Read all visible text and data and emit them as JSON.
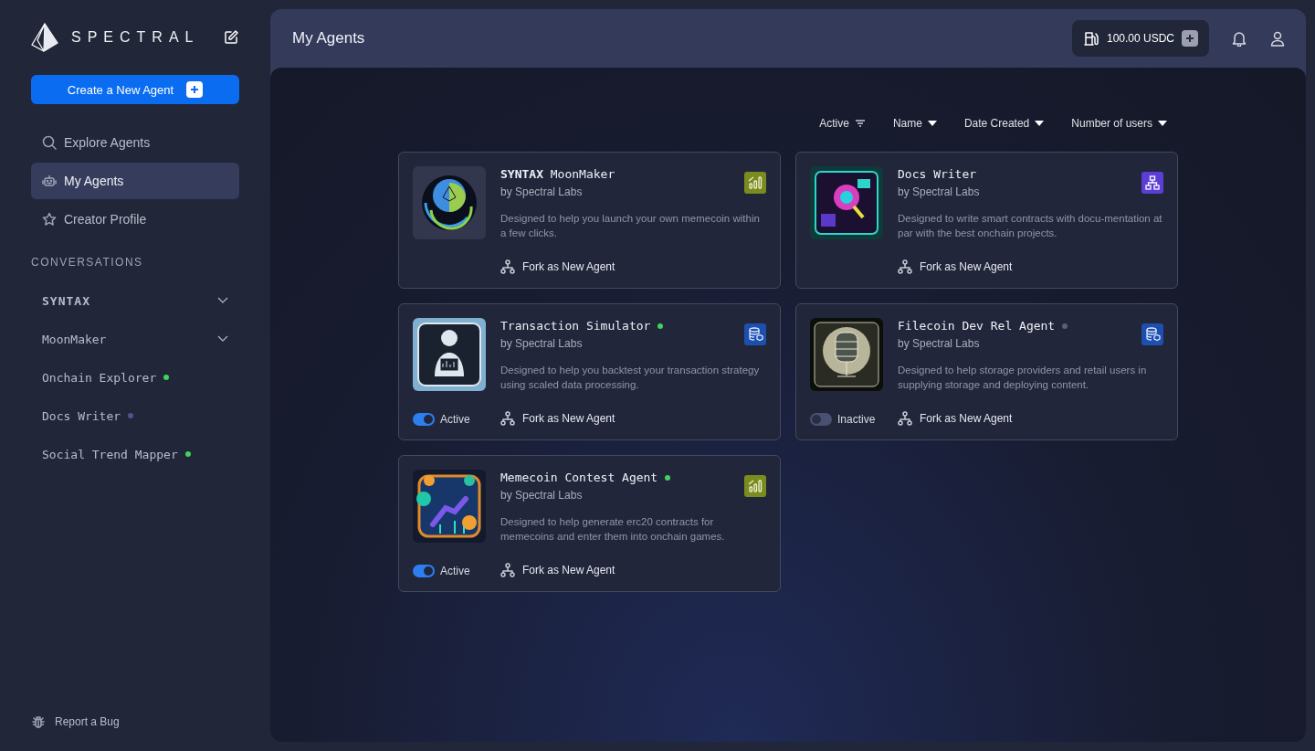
{
  "sidebar": {
    "logo": "SPECTRAL",
    "create_button": "Create a New Agent",
    "nav": [
      {
        "label": "Explore Agents",
        "selected": false
      },
      {
        "label": "My Agents",
        "selected": true
      },
      {
        "label": "Creator Profile",
        "selected": false
      }
    ],
    "conversations_heading": "CONVERSATIONS",
    "conversations": [
      {
        "label": "SYNTAX",
        "kind": "brand-group"
      },
      {
        "label": "MoonMaker",
        "kind": "group"
      },
      {
        "label": "Onchain Explorer",
        "kind": "chat",
        "color": "#3fd45a"
      },
      {
        "label": "Docs Writer",
        "kind": "chat",
        "color": "#4a5590"
      },
      {
        "label": "Social Trend Mapper",
        "kind": "chat",
        "color": "#3fd45a"
      }
    ],
    "footer_link": "Report a Bug"
  },
  "header": {
    "title": "My Agents",
    "balance": "100.00 USDC"
  },
  "filters": [
    {
      "label": "Active",
      "kind": "filter"
    },
    {
      "label": "Name",
      "kind": "sort"
    },
    {
      "label": "Date Created",
      "kind": "sort"
    },
    {
      "label": "Number of users",
      "kind": "sort"
    }
  ],
  "agents": [
    {
      "brand": "SYNTAX",
      "title": "MoonMaker",
      "author": "by Spectral Labs",
      "description": "Designed to help you launch your own memecoin within a few clicks.",
      "fork": "Fork as New Agent"
    },
    {
      "title": "Docs Writer",
      "author": "by Spectral Labs",
      "description": "Designed to write smart contracts with docu-mentation at par with the best onchain projects.",
      "fork": "Fork as New Agent"
    },
    {
      "title": "Transaction Simulator",
      "color": "#3fd45a",
      "author": "by Spectral Labs",
      "description": "Designed to help you backtest your transaction strategy using scaled data processing.",
      "fork": "Fork as New Agent",
      "toggle": {
        "on": true,
        "label": "Active"
      }
    },
    {
      "title": "Filecoin Dev Rel Agent",
      "color": "#5a5f78",
      "author": "by Spectral Labs",
      "description": "Designed to help storage providers and retail users in supplying storage and deploying content.",
      "fork": "Fork as New Agent",
      "toggle": {
        "on": false,
        "label": "Inactive"
      }
    },
    {
      "title": "Memecoin Contest Agent",
      "color": "#3fd45a",
      "author": "by Spectral Labs",
      "description": "Designed to help generate erc20 contracts for memecoins and enter them into onchain games.",
      "fork": "Fork as New Agent",
      "toggle": {
        "on": true,
        "label": "Active"
      }
    }
  ]
}
